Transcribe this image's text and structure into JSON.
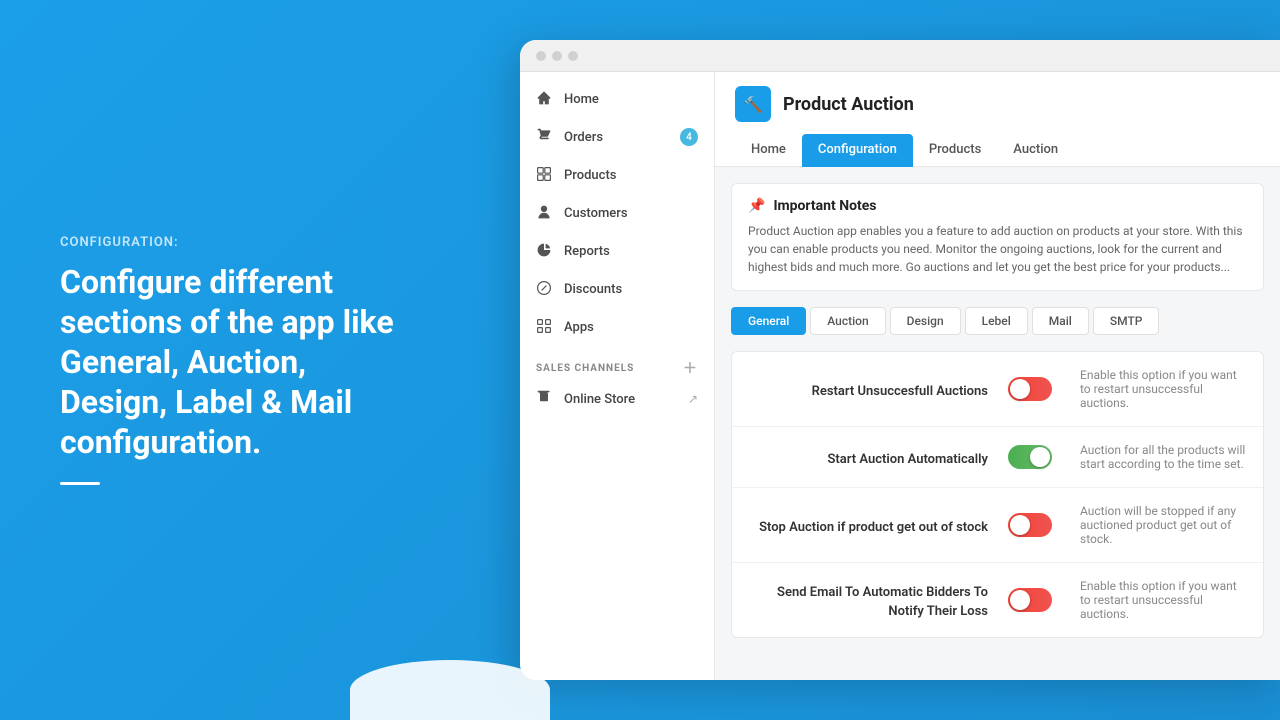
{
  "left": {
    "label": "CONFIGURATION:",
    "heading": "Configure different sections of the app like General, Auction, Design, Label & Mail configuration."
  },
  "sidebar": {
    "items": [
      {
        "id": "home",
        "label": "Home",
        "icon": "home"
      },
      {
        "id": "orders",
        "label": "Orders",
        "icon": "orders",
        "badge": "4"
      },
      {
        "id": "products",
        "label": "Products",
        "icon": "products"
      },
      {
        "id": "customers",
        "label": "Customers",
        "icon": "customers"
      },
      {
        "id": "reports",
        "label": "Reports",
        "icon": "reports"
      },
      {
        "id": "discounts",
        "label": "Discounts",
        "icon": "discounts"
      },
      {
        "id": "apps",
        "label": "Apps",
        "icon": "apps"
      }
    ],
    "salesChannels": {
      "label": "SALES CHANNELS",
      "items": [
        {
          "id": "online-store",
          "label": "Online Store"
        }
      ]
    }
  },
  "appHeader": {
    "title": "Product Auction",
    "tabs": [
      {
        "id": "home",
        "label": "Home"
      },
      {
        "id": "configuration",
        "label": "Configuration",
        "active": true
      },
      {
        "id": "products",
        "label": "Products"
      },
      {
        "id": "auction",
        "label": "Auction"
      }
    ]
  },
  "notes": {
    "title": "Important Notes",
    "text": "Product Auction app enables you a feature to add auction on products at your store. With this you can enable products you need. Monitor the ongoing auctions, look for the current and highest bids and much more. Go auctions and let you get the best price for your products..."
  },
  "subTabs": [
    {
      "id": "general",
      "label": "General",
      "active": true
    },
    {
      "id": "auction",
      "label": "Auction"
    },
    {
      "id": "design",
      "label": "Design"
    },
    {
      "id": "label",
      "label": "Lebel"
    },
    {
      "id": "mail",
      "label": "Mail"
    },
    {
      "id": "smtp",
      "label": "SMTP"
    }
  ],
  "settings": [
    {
      "id": "restart-unsuccessful",
      "label": "Restart Unsuccesfull Auctions",
      "toggle": "off",
      "description": "Enable this option if you want to restart unsuccessful auctions."
    },
    {
      "id": "start-automatically",
      "label": "Start Auction Automatically",
      "toggle": "on",
      "description": "Auction for all the products will start according to the time set."
    },
    {
      "id": "stop-out-of-stock",
      "label": "Stop Auction if product get out of stock",
      "toggle": "off",
      "description": "Auction will be stopped if any auctioned product get out of stock."
    },
    {
      "id": "send-email",
      "label": "Send Email To Automatic Bidders To Notify Their Loss",
      "toggle": "off",
      "description": "Enable this option if you want to restart unsuccessful auctions."
    }
  ]
}
